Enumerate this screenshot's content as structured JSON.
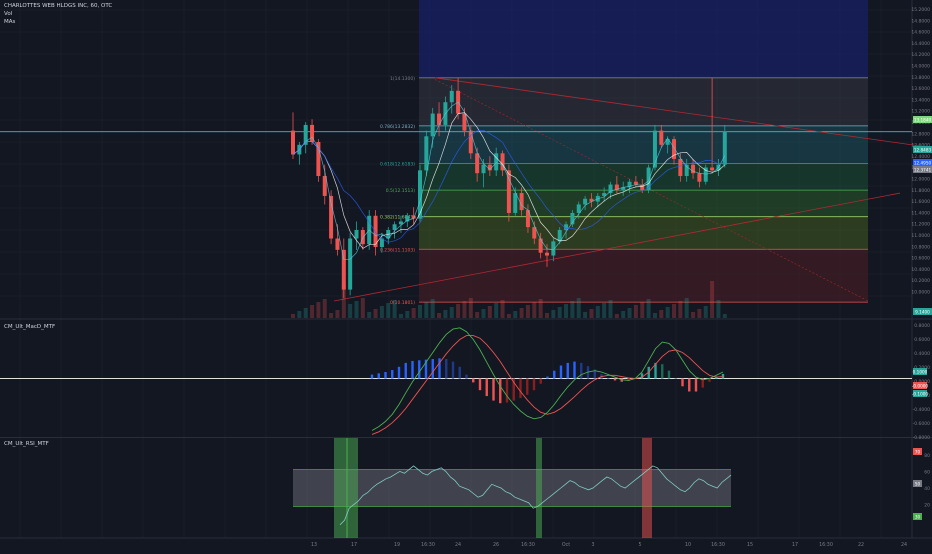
{
  "header": {
    "symbol_line": "CHARLOTTES WEB HLDGS INC, 60, OTC",
    "vol_label": "Vol",
    "mas_label": "MAs"
  },
  "panes": {
    "macd_label": "CM_Ult_MacD_MTF",
    "rsi_label": "CM_Ult_RSI_MTF"
  },
  "colors": {
    "bg": "#131722",
    "up": "#26a69a",
    "down": "#ef5350",
    "grid": "#1e222d",
    "axis_text": "#787b86"
  },
  "chart_data": [
    {
      "type": "candlestick",
      "pane": "price",
      "yaxis_ticks": [
        "15.2000",
        "14.8000",
        "14.6000",
        "14.4000",
        "14.2000",
        "14.0000",
        "13.8000",
        "13.6000",
        "13.4000",
        "13.2000",
        "13.0000",
        "12.8000",
        "12.6000",
        "12.4000",
        "12.2000",
        "12.0000",
        "11.8000",
        "11.6000",
        "11.4000",
        "11.2000",
        "11.0000",
        "10.8000",
        "10.6000",
        "10.4000",
        "10.2000",
        "10.0000"
      ],
      "ylim": [
        9.9,
        15.5
      ],
      "xaxis_ticks": [
        "13",
        "17",
        "19",
        "16:30",
        "24",
        "26",
        "16:30",
        "Oct",
        "3",
        "5",
        "10",
        "16:30",
        "15",
        "17",
        "16:30",
        "22",
        "24"
      ],
      "price_badges": [
        {
          "text": "13.1840",
          "color": "#7dd87d"
        },
        {
          "text": "12.8483",
          "color": "#26a69a"
        },
        {
          "text": "12.4950",
          "color": "#2962ff"
        },
        {
          "text": "12.3741",
          "color": "#787b86"
        },
        {
          "text": "9.1400",
          "color": "#26a69a"
        }
      ],
      "fib_levels": [
        {
          "label": "1(14.1300)",
          "value": 14.13
        },
        {
          "label": "0.786(13.2832)",
          "value": 13.2832
        },
        {
          "label": "0.618(12.6183)",
          "value": 12.6183
        },
        {
          "label": "0.5(12.1513)",
          "value": 12.1513
        },
        {
          "label": "0.382(11.6843)",
          "value": 11.6843
        },
        {
          "label": "0.236(11.1103)",
          "value": 11.1103
        },
        {
          "label": "0(10.1801)",
          "value": 10.1801
        }
      ],
      "candles": [
        [
          13.2,
          13.52,
          12.7,
          12.78
        ],
        [
          12.78,
          13.0,
          12.6,
          12.95
        ],
        [
          12.95,
          13.35,
          12.8,
          13.3
        ],
        [
          13.3,
          13.4,
          12.95,
          13.0
        ],
        [
          13.0,
          13.05,
          12.3,
          12.4
        ],
        [
          12.4,
          12.6,
          11.9,
          12.05
        ],
        [
          12.05,
          12.15,
          11.2,
          11.3
        ],
        [
          11.3,
          11.55,
          11.0,
          11.1
        ],
        [
          11.1,
          11.3,
          10.25,
          10.4
        ],
        [
          10.4,
          11.4,
          10.3,
          11.3
        ],
        [
          11.3,
          11.6,
          11.1,
          11.45
        ],
        [
          11.45,
          11.5,
          11.1,
          11.2
        ],
        [
          11.2,
          11.8,
          11.1,
          11.7
        ],
        [
          11.7,
          11.8,
          11.0,
          11.15
        ],
        [
          11.15,
          11.4,
          11.05,
          11.3
        ],
        [
          11.3,
          11.5,
          11.2,
          11.45
        ],
        [
          11.45,
          11.6,
          11.3,
          11.55
        ],
        [
          11.55,
          11.7,
          11.4,
          11.6
        ],
        [
          11.6,
          11.75,
          11.5,
          11.7
        ],
        [
          11.7,
          11.85,
          11.55,
          11.65
        ],
        [
          11.65,
          12.6,
          11.6,
          12.5
        ],
        [
          12.5,
          13.2,
          12.4,
          13.1
        ],
        [
          13.1,
          13.6,
          12.9,
          13.5
        ],
        [
          13.5,
          13.7,
          13.1,
          13.3
        ],
        [
          13.3,
          13.8,
          13.2,
          13.7
        ],
        [
          13.7,
          14.0,
          13.5,
          13.9
        ],
        [
          13.9,
          14.13,
          13.4,
          13.5
        ],
        [
          13.5,
          13.6,
          13.1,
          13.2
        ],
        [
          13.2,
          13.3,
          12.7,
          12.8
        ],
        [
          12.8,
          12.9,
          12.3,
          12.45
        ],
        [
          12.45,
          12.7,
          12.2,
          12.6
        ],
        [
          12.6,
          12.75,
          12.4,
          12.5
        ],
        [
          12.5,
          12.9,
          12.4,
          12.8
        ],
        [
          12.8,
          12.85,
          12.4,
          12.5
        ],
        [
          12.5,
          12.6,
          11.6,
          11.75
        ],
        [
          11.75,
          12.2,
          11.7,
          12.1
        ],
        [
          12.1,
          12.2,
          11.7,
          11.8
        ],
        [
          11.8,
          11.9,
          11.4,
          11.5
        ],
        [
          11.5,
          11.6,
          11.2,
          11.3
        ],
        [
          11.3,
          11.4,
          10.95,
          11.05
        ],
        [
          11.05,
          11.2,
          10.8,
          11.0
        ],
        [
          11.0,
          11.3,
          10.9,
          11.25
        ],
        [
          11.25,
          11.5,
          11.2,
          11.45
        ],
        [
          11.45,
          11.6,
          11.3,
          11.55
        ],
        [
          11.55,
          11.8,
          11.5,
          11.75
        ],
        [
          11.75,
          11.95,
          11.65,
          11.9
        ],
        [
          11.9,
          12.05,
          11.8,
          12.0
        ],
        [
          12.0,
          12.1,
          11.85,
          11.95
        ],
        [
          11.95,
          12.1,
          11.85,
          12.05
        ],
        [
          12.05,
          12.2,
          11.95,
          12.1
        ],
        [
          12.1,
          12.3,
          12.0,
          12.25
        ],
        [
          12.25,
          12.4,
          12.1,
          12.15
        ],
        [
          12.15,
          12.3,
          12.05,
          12.2
        ],
        [
          12.2,
          12.35,
          12.1,
          12.3
        ],
        [
          12.3,
          12.4,
          12.2,
          12.25
        ],
        [
          12.25,
          12.35,
          12.1,
          12.15
        ],
        [
          12.15,
          12.6,
          12.1,
          12.55
        ],
        [
          12.55,
          13.3,
          12.5,
          13.2
        ],
        [
          13.2,
          13.3,
          12.9,
          12.95
        ],
        [
          12.95,
          13.1,
          12.8,
          13.05
        ],
        [
          13.05,
          13.1,
          12.6,
          12.7
        ],
        [
          12.7,
          12.8,
          12.3,
          12.4
        ],
        [
          12.4,
          12.7,
          12.3,
          12.6
        ],
        [
          12.6,
          12.7,
          12.35,
          12.45
        ],
        [
          12.45,
          12.55,
          12.2,
          12.3
        ],
        [
          12.3,
          12.6,
          12.25,
          12.55
        ],
        [
          12.55,
          14.13,
          12.45,
          12.5
        ],
        [
          12.5,
          12.7,
          12.4,
          12.6
        ],
        [
          12.6,
          13.3,
          12.55,
          13.18
        ]
      ]
    },
    {
      "type": "macd",
      "pane": "macd",
      "yaxis_ticks": [
        "0.8000",
        "0.6000",
        "0.4000",
        "0.2000",
        "0.0000",
        "-0.2000",
        "-0.4000",
        "-0.6000",
        "-0.8000"
      ],
      "ylim": [
        -0.9,
        0.9
      ],
      "badges": [
        "0.1000",
        "-0.0000",
        "-0.1000"
      ],
      "macd_line": [
        -0.8,
        -0.74,
        -0.66,
        -0.55,
        -0.4,
        -0.22,
        -0.05,
        0.1,
        0.25,
        0.4,
        0.55,
        0.68,
        0.76,
        0.78,
        0.72,
        0.6,
        0.44,
        0.25,
        0.06,
        -0.12,
        -0.27,
        -0.4,
        -0.5,
        -0.58,
        -0.62,
        -0.6,
        -0.52,
        -0.4,
        -0.26,
        -0.13,
        -0.02,
        0.06,
        0.1,
        0.12,
        0.1,
        0.06,
        0.02,
        -0.02,
        -0.03,
        0.0,
        0.1,
        0.28,
        0.46,
        0.56,
        0.54,
        0.44,
        0.28,
        0.12,
        0.02,
        -0.02,
        0.0,
        0.05,
        0.1
      ],
      "signal_line": [
        -0.86,
        -0.82,
        -0.76,
        -0.68,
        -0.58,
        -0.46,
        -0.32,
        -0.18,
        -0.04,
        0.1,
        0.24,
        0.38,
        0.5,
        0.6,
        0.66,
        0.66,
        0.62,
        0.52,
        0.4,
        0.26,
        0.1,
        -0.06,
        -0.2,
        -0.33,
        -0.44,
        -0.52,
        -0.55,
        -0.52,
        -0.46,
        -0.37,
        -0.28,
        -0.18,
        -0.09,
        -0.02,
        0.03,
        0.05,
        0.05,
        0.03,
        0.01,
        0.0,
        0.02,
        0.1,
        0.22,
        0.34,
        0.42,
        0.44,
        0.4,
        0.32,
        0.22,
        0.12,
        0.05,
        0.02,
        0.03
      ],
      "histogram": [
        0.06,
        0.08,
        0.1,
        0.13,
        0.18,
        0.24,
        0.27,
        0.28,
        0.29,
        0.3,
        0.31,
        0.3,
        0.26,
        0.18,
        0.06,
        -0.06,
        -0.18,
        -0.27,
        -0.34,
        -0.38,
        -0.37,
        -0.34,
        -0.3,
        -0.25,
        -0.18,
        -0.08,
        0.03,
        0.12,
        0.2,
        0.24,
        0.26,
        0.24,
        0.19,
        0.14,
        0.07,
        0.01,
        -0.03,
        -0.05,
        -0.04,
        0.0,
        0.08,
        0.18,
        0.24,
        0.22,
        0.12,
        0.0,
        -0.12,
        -0.2,
        -0.2,
        -0.14,
        -0.05,
        0.03,
        0.07
      ]
    },
    {
      "type": "line",
      "pane": "rsi",
      "yaxis_ticks": [
        "80",
        "60",
        "40",
        "20"
      ],
      "ylim": [
        0,
        100
      ],
      "bands": [
        70,
        30
      ],
      "badges": [
        "70",
        "50",
        "30"
      ],
      "values": [
        10,
        15,
        28,
        32,
        36,
        42,
        45,
        50,
        54,
        57,
        60,
        62,
        65,
        68,
        66,
        70,
        74,
        70,
        66,
        64,
        68,
        70,
        72,
        68,
        62,
        58,
        52,
        50,
        48,
        44,
        40,
        42,
        48,
        54,
        52,
        50,
        46,
        44,
        40,
        38,
        36,
        34,
        28,
        30,
        34,
        38,
        42,
        46,
        50,
        54,
        58,
        56,
        52,
        50,
        48,
        50,
        54,
        58,
        62,
        60,
        56,
        52,
        50,
        54,
        58,
        62,
        66,
        70,
        74,
        72,
        66,
        60,
        56,
        52,
        48,
        46,
        50,
        56,
        60,
        58,
        54,
        52,
        50,
        56,
        60,
        64
      ]
    }
  ]
}
